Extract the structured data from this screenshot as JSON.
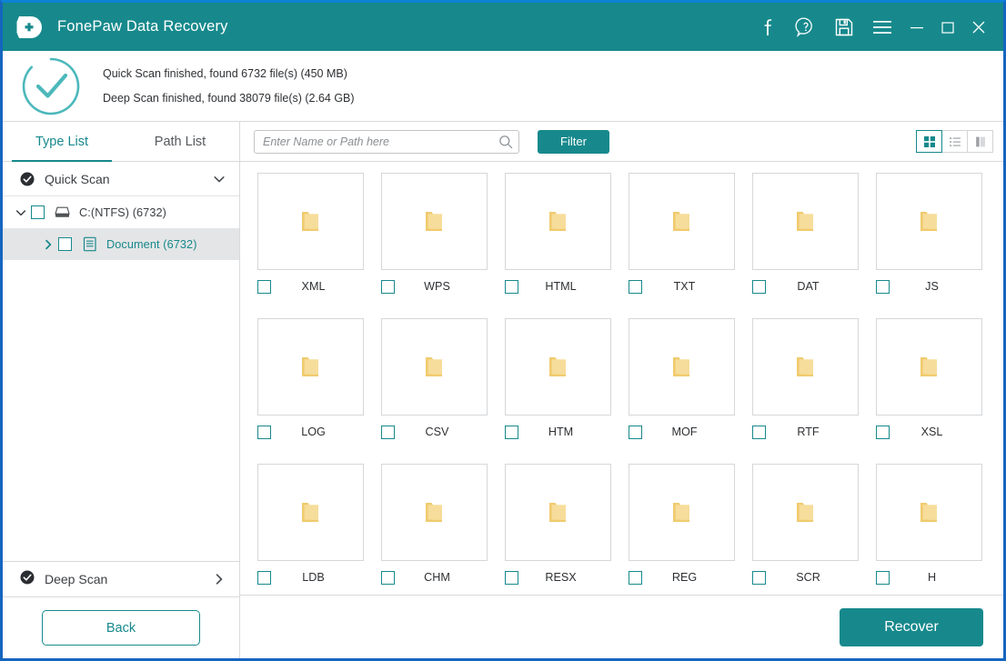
{
  "theme": {
    "accent": "#17898c",
    "window_border": "#1565c0",
    "folder": "#f2d17c"
  },
  "titlebar": {
    "app_title": "FonePaw Data Recovery",
    "icons": [
      {
        "name": "facebook-icon",
        "glyph": "f"
      },
      {
        "name": "help-icon",
        "glyph": "?"
      },
      {
        "name": "save-icon",
        "glyph": "save"
      },
      {
        "name": "menu-icon",
        "glyph": "hamburger"
      },
      {
        "name": "minimize-button",
        "glyph": "minimize"
      },
      {
        "name": "maximize-button",
        "glyph": "maximize"
      },
      {
        "name": "close-button",
        "glyph": "close"
      }
    ]
  },
  "scan_summary": {
    "status_icon": "check-circle-icon",
    "quick_scan": "Quick Scan finished, found 6732 file(s) (450 MB)",
    "deep_scan": "Deep Scan finished, found 38079 file(s) (2.64 GB)"
  },
  "sidebar": {
    "tabs": [
      {
        "label": "Type List",
        "active": true
      },
      {
        "label": "Path List",
        "active": false
      }
    ],
    "quick_scan": {
      "label": "Quick Scan",
      "expanded": true
    },
    "tree": [
      {
        "label": "C:(NTFS) (6732)",
        "level": 0,
        "expanded": true,
        "icon": "drive-icon",
        "selected": false
      },
      {
        "label": "Document (6732)",
        "level": 1,
        "expanded": false,
        "icon": "document-icon",
        "selected": true
      }
    ],
    "deep_scan": {
      "label": "Deep Scan",
      "expanded": false
    },
    "back_label": "Back"
  },
  "toolbar": {
    "search_placeholder": "Enter Name or Path here",
    "search_value": "",
    "filter_label": "Filter",
    "view_modes": [
      {
        "name": "grid-view-button",
        "active": true
      },
      {
        "name": "list-view-button",
        "active": false
      },
      {
        "name": "detail-view-button",
        "active": false
      }
    ]
  },
  "grid": {
    "items": [
      {
        "label": "XML",
        "checked": false
      },
      {
        "label": "WPS",
        "checked": false
      },
      {
        "label": "HTML",
        "checked": false
      },
      {
        "label": "TXT",
        "checked": false
      },
      {
        "label": "DAT",
        "checked": false
      },
      {
        "label": "JS",
        "checked": false
      },
      {
        "label": "LOG",
        "checked": false
      },
      {
        "label": "CSV",
        "checked": false
      },
      {
        "label": "HTM",
        "checked": false
      },
      {
        "label": "MOF",
        "checked": false
      },
      {
        "label": "RTF",
        "checked": false
      },
      {
        "label": "XSL",
        "checked": false
      },
      {
        "label": "LDB",
        "checked": false
      },
      {
        "label": "CHM",
        "checked": false
      },
      {
        "label": "RESX",
        "checked": false
      },
      {
        "label": "REG",
        "checked": false
      },
      {
        "label": "SCR",
        "checked": false
      },
      {
        "label": "H",
        "checked": false
      }
    ]
  },
  "footer": {
    "recover_label": "Recover"
  }
}
